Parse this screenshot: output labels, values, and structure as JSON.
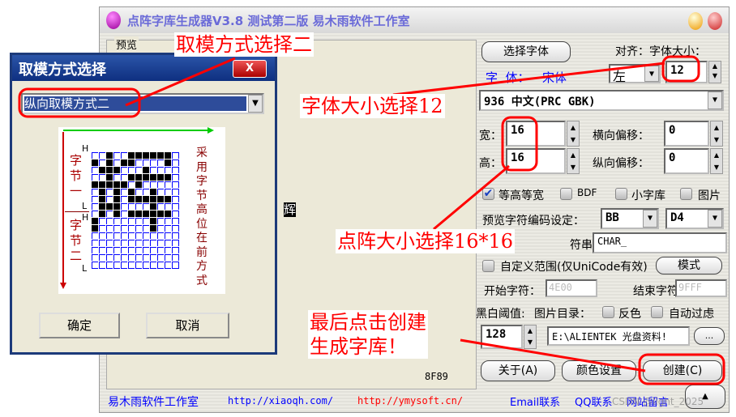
{
  "window": {
    "title": "点阵字库生成器V3.8 测试第二版 易木雨软件工作室"
  },
  "preview": {
    "label": "预览",
    "char": "辉",
    "code": "8F89"
  },
  "right": {
    "select_font": "选择字体",
    "align_size_label": "对齐：字体大小：",
    "font_label": "字  体：",
    "font_name": "宋体",
    "align_value": "左",
    "font_size": "12",
    "codepage": "936 中文(PRC GBK)",
    "width_label": "宽：",
    "width": "16",
    "height_label": "高：",
    "height": "16",
    "hoffset_label": "横向偏移：",
    "hoffset": "0",
    "voffset_label": "纵向偏移：",
    "voffset": "0",
    "equal_label": "等高等宽",
    "equal_checked": true,
    "bdf_label": "BDF",
    "small_label": "小字库",
    "image_label": "图片",
    "preview_code_label": "预览字符编码设定：",
    "code_hi": "BB",
    "code_lo": "D4",
    "string_label": "符串：",
    "string_value": "CHAR_",
    "custom_range_label": "自定义范围(仅UniCode有效)",
    "mode_button": "模式",
    "start_label": "开始字符：",
    "start_value": "4E00",
    "end_label": "结束字符：",
    "end_value": "9FFF",
    "threshold_label": "黑白阈值:",
    "imgdir_label": "图片目录：",
    "invert_label": "反色",
    "autofilter_label": "自动过虑",
    "threshold": "128",
    "path": "E:\\ALIENTEK 光盘资料!",
    "browse": "...",
    "about": "关于(A)",
    "color": "颜色设置",
    "create": "创建(C)"
  },
  "footer": {
    "studio": "易木雨软件工作室",
    "url1": "http://xiaoqh.com/",
    "url2": "http://ymysoft.cn/",
    "email": "Email联系",
    "qq": "QQ联系",
    "msg": "网站留言",
    "up": "▲",
    "watermark": "CSDN @light_2025"
  },
  "dialog": {
    "title": "取模方式选择",
    "close": "X",
    "mode": "纵向取模方式二",
    "byte1": "字节一",
    "byte2": "字节二",
    "h": "H",
    "l": "L",
    "note": "采用字节高位在前方式",
    "ok": "确定",
    "cancel": "取消",
    "bitmap": [
      "001001111110",
      "101011000010",
      "011100010000",
      "001001111110",
      "111110100000",
      "010101001000",
      "010101111110",
      "011100001000",
      "010101111110",
      "100000001000",
      "100000001000",
      "000000000000",
      "000000000000",
      "000000000000",
      "000000000000",
      "000000000000"
    ]
  },
  "annotations": {
    "a1": "取模方式选择二",
    "a2": "字体大小选择12",
    "a3": "点阵大小选择16*16",
    "a4_line1": "最后点击创建",
    "a4_line2": "生成字库！"
  },
  "colors": {
    "annotation": "#ff0000",
    "link_blue": "#0000ff",
    "link_red": "#ff0000"
  }
}
